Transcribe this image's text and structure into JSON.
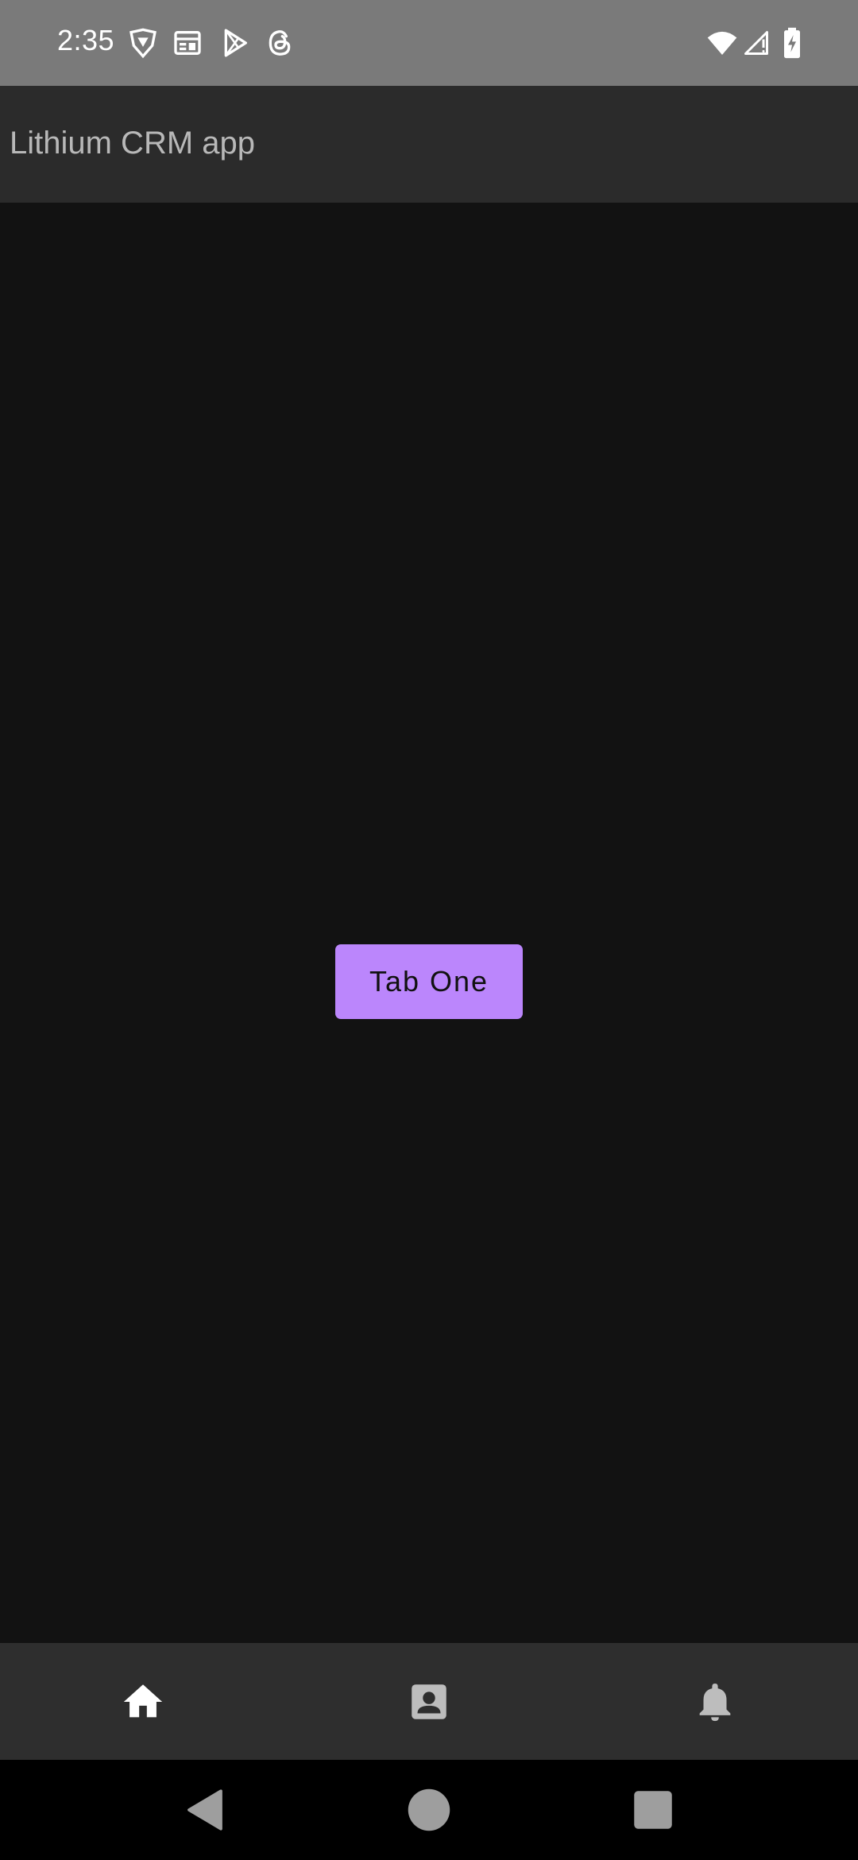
{
  "status_bar": {
    "time": "2:35",
    "left_icons": [
      "vpn-shield-icon",
      "calendar-icon",
      "play-store-icon",
      "threads-icon"
    ],
    "right_icons": [
      "wifi-icon",
      "cellular-signal-icon",
      "battery-charging-icon"
    ]
  },
  "app_bar": {
    "title": "Lithium CRM app"
  },
  "main": {
    "button_label": "Tab One",
    "button_color": "#bb86fc"
  },
  "bottom_nav": {
    "items": [
      {
        "icon": "home-icon",
        "active": true
      },
      {
        "icon": "contact-icon",
        "active": false
      },
      {
        "icon": "bell-icon",
        "active": false
      }
    ]
  },
  "system_nav": {
    "buttons": [
      "back-icon",
      "home-circle-icon",
      "recents-icon"
    ]
  },
  "colors": {
    "status_bar": "#7a7a7a",
    "app_bar": "#2b2b2b",
    "background": "#121212",
    "bottom_nav": "#2e2e2e",
    "active_icon": "#ffffff",
    "inactive_icon": "#bdbdbd"
  }
}
